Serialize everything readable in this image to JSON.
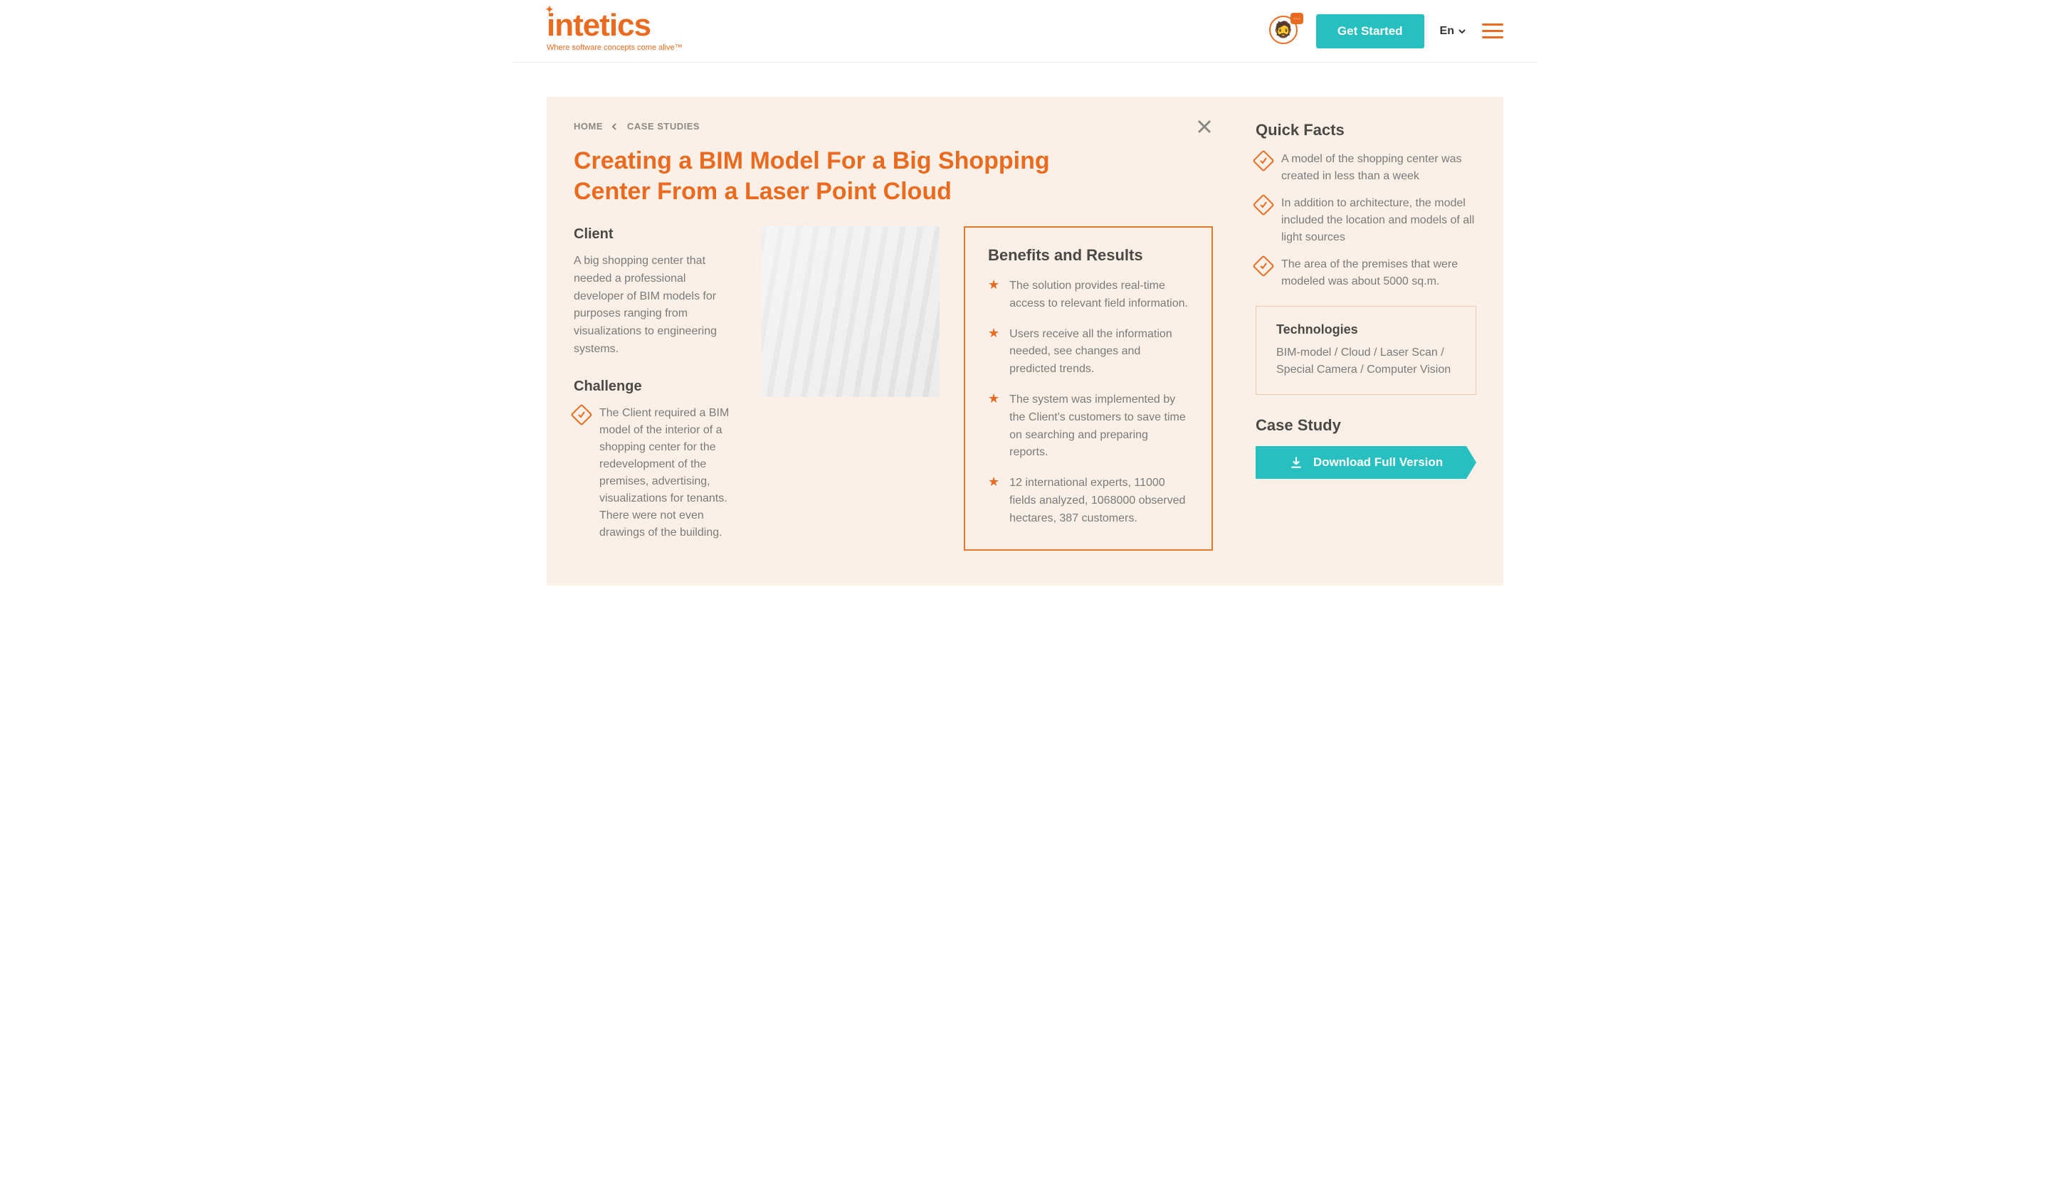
{
  "header": {
    "logo_main": "intetics",
    "logo_tag": "Where software concepts come alive™",
    "get_started": "Get Started",
    "lang": "En"
  },
  "breadcrumb": {
    "home": "HOME",
    "section": "CASE STUDIES"
  },
  "title": "Creating a BIM Model For a Big Shopping Center From a Laser Point Cloud",
  "client": {
    "heading": "Client",
    "text": "A big shopping center that needed a professional developer of BIM models for purposes ranging from visualizations to engineering systems."
  },
  "challenge": {
    "heading": "Challenge",
    "text": "The Client required a BIM model of the interior of a shopping center for the redevelopment of the premises, advertising, visualizations for tenants. There were not even drawings of the building."
  },
  "benefits": {
    "heading": "Benefits and Results",
    "items": [
      "The solution provides real-time access to relevant field information.",
      "Users receive all the information needed, see changes and predicted trends.",
      "The system was implemented by the Client's customers to save time on searching and preparing reports.",
      "12 international experts, 11000 fields analyzed, 1068000 observed hectares, 387 customers."
    ]
  },
  "sidebar": {
    "quick_facts_heading": "Quick Facts",
    "quick_facts": [
      "A model of the shopping center was created in less than a week",
      "In addition to architecture, the model included the location and models of all light sources",
      "The area of the premises that were modeled was about 5000 sq.m."
    ],
    "tech_heading": "Technologies",
    "tech_text": "BIM-model / Cloud / Laser Scan / Special Camera / Computer Vision",
    "case_study_heading": "Case Study",
    "download": "Download Full Version"
  }
}
